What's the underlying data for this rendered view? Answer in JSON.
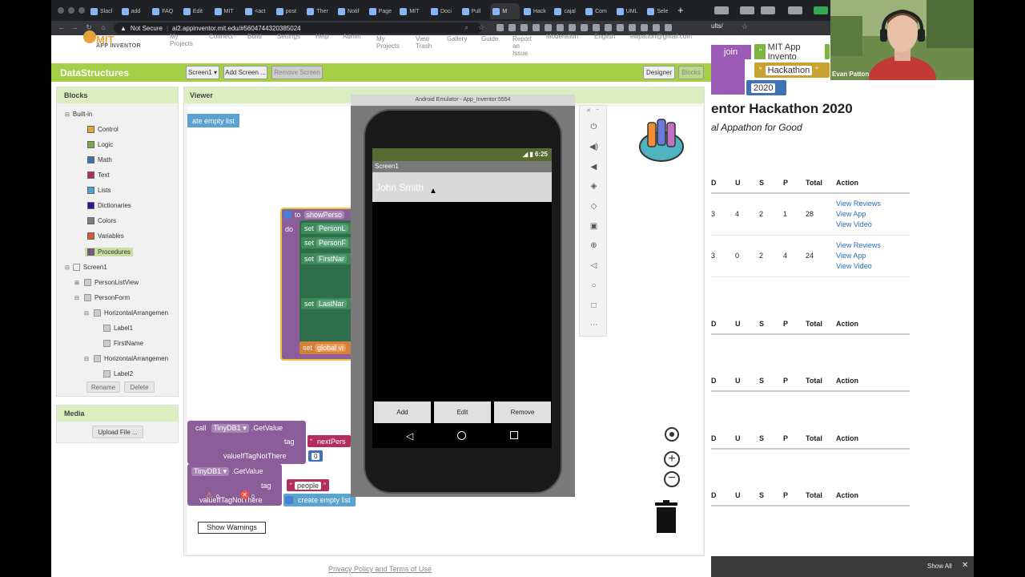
{
  "browser": {
    "tabs": [
      "Slacl",
      "add",
      "FAQ",
      "Edit",
      "MIT",
      "<act",
      "post",
      "Ther",
      "Notif",
      "Page",
      "MIT",
      "Doci",
      "Pull",
      "M",
      "Hack",
      "cajal",
      "Com",
      "UML",
      "Sele"
    ],
    "address": {
      "security": "Not Secure",
      "url": "ai2.appinventor.mit.edu/#5604744320385024"
    },
    "new_tab": "+"
  },
  "ai_nav": {
    "logo_text": "MIT",
    "logo_sub": "APP INVENTOR",
    "items": [
      {
        "label": "My\nProjects"
      },
      {
        "label": "Connect"
      },
      {
        "label": "Build"
      },
      {
        "label": "Settings"
      },
      {
        "label": "Help"
      },
      {
        "label": "Admin"
      },
      {
        "label": "My\nProjects"
      },
      {
        "label": "View\nTrash"
      },
      {
        "label": "Gallery"
      },
      {
        "label": "Guide"
      },
      {
        "label": "Report\nan\nIssue"
      },
      {
        "label": "Moderation"
      },
      {
        "label": "English"
      },
      {
        "label": "ewpatton@gmail.com"
      }
    ]
  },
  "project": {
    "name": "DataStructures",
    "screen_select": "Screen1 ▾",
    "add_screen": "Add Screen ...",
    "remove_screen": "Remove Screen",
    "designer": "Designer",
    "blocks": "Blocks"
  },
  "blocks_panel": {
    "title": "Blocks",
    "builtin": "Built-in",
    "builtin_items": [
      {
        "label": "Control",
        "color": "#e1a93a"
      },
      {
        "label": "Logic",
        "color": "#77ab41"
      },
      {
        "label": "Math",
        "color": "#3f71b5"
      },
      {
        "label": "Text",
        "color": "#b32d5e"
      },
      {
        "label": "Lists",
        "color": "#49a6d4"
      },
      {
        "label": "Dictionaries",
        "color": "#2d1799"
      },
      {
        "label": "Colors",
        "color": "#7d7d7d"
      },
      {
        "label": "Variables",
        "color": "#d05f2d"
      },
      {
        "label": "Procedures",
        "color": "#7c5385"
      }
    ],
    "screen": "Screen1",
    "components": [
      {
        "label": "PersonListView",
        "level": 1,
        "toggle": "⊞"
      },
      {
        "label": "PersonForm",
        "level": 1,
        "toggle": "⊟"
      },
      {
        "label": "HorizontalArrangemen",
        "level": 2,
        "toggle": "⊟"
      },
      {
        "label": "Label1",
        "level": 3,
        "toggle": ""
      },
      {
        "label": "FirstName",
        "level": 3,
        "toggle": ""
      },
      {
        "label": "HorizontalArrangemen",
        "level": 2,
        "toggle": "⊟"
      },
      {
        "label": "Label2",
        "level": 3,
        "toggle": ""
      }
    ],
    "rename": "Rename",
    "delete": "Delete"
  },
  "media_panel": {
    "title": "Media",
    "upload": "Upload File ..."
  },
  "viewer": {
    "title": "Viewer",
    "blocks": {
      "create_empty_list_top": "ate empty list",
      "to": "to",
      "proc_name": "showPerso",
      "do": "do",
      "set1": "set",
      "set1_target": "PersonL",
      "set2": "set",
      "set2_target": "PersonF",
      "set3": "set",
      "set3_target": "FirstNar",
      "set4": "set",
      "set4_target": "LastNar",
      "set5": "set",
      "set5_target": "global vi",
      "call": "call",
      "tinydb1": "TinyDB1 ▾",
      "getvalue": ".GetValue",
      "tag": "tag",
      "next_pers": "nextPers",
      "value_if": "valueIfTagNotThere",
      "zero": "0",
      "tinydb1b": "TinyDB1 ▾",
      "getvalue2": ".GetValue",
      "tag2": "tag",
      "people": "people",
      "value_if2": "valueIfTagNotThere",
      "create_empty_list": "create empty list"
    },
    "warnings": {
      "warn_count": "0",
      "err_count": "0",
      "show_warnings": "Show Warnings"
    },
    "footer_link": "Privacy Policy and Terms of Use"
  },
  "emulator": {
    "title": "Android Emulator - App_Inventor:5554",
    "time": "6:25",
    "app_title": "Screen1",
    "list_item": "John Smith",
    "buttons": [
      "Add",
      "Edit",
      "Remove"
    ],
    "side_icons": [
      "power-icon",
      "volume-up-icon",
      "volume-down-icon",
      "rotate-left-icon",
      "rotate-right-icon",
      "camera-icon",
      "zoom-icon",
      "back-icon",
      "home-icon",
      "overview-icon",
      "more-icon"
    ]
  },
  "right_window": {
    "url_fragment": "ults/",
    "block_join": "join",
    "block_str1": "MIT App Invento",
    "block_str2": "Hackathon",
    "block_num": "2020",
    "title": "entor Hackathon 2020",
    "subtitle": "al Appathon for Good",
    "headers": [
      "D",
      "U",
      "S",
      "P",
      "Total",
      "Action"
    ],
    "rows": [
      {
        "d": "3",
        "u": "4",
        "s": "2",
        "p": "1",
        "total": "28",
        "links": [
          "View Reviews",
          "View App",
          "View Video"
        ]
      },
      {
        "d": "3",
        "u": "0",
        "s": "2",
        "p": "4",
        "total": "24",
        "links": [
          "View Reviews",
          "View App",
          "View Video"
        ]
      }
    ],
    "show_all": "Show All",
    "close": "✕"
  },
  "webcam": {
    "name": "Evan Patton"
  }
}
